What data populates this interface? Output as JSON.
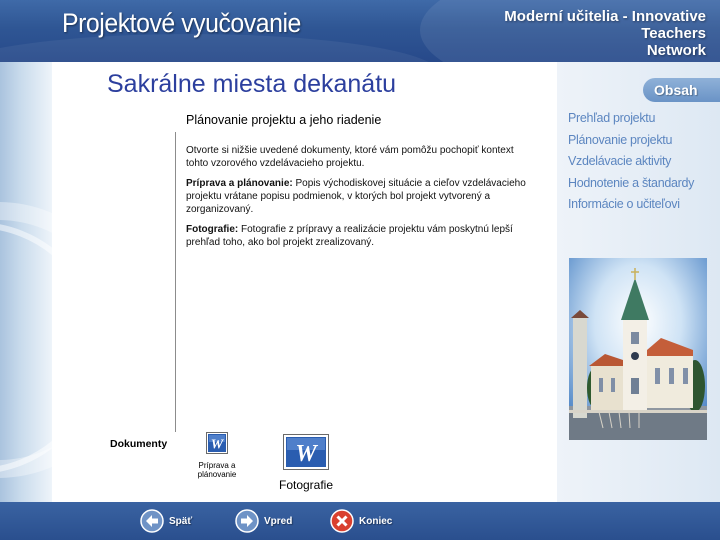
{
  "header": {
    "title": "Projektové vyučovanie",
    "network_lines": [
      "Moderní učitelia - Innovative",
      "Teachers",
      "Network"
    ]
  },
  "main": {
    "page_title": "Sakrálne miesta dekanátu",
    "section_heading": "Plánovanie projektu a jeho riadenie",
    "intro": "Otvorte si nižšie uvedené dokumenty, ktoré vám pomôžu pochopiť kontext tohto vzorového vzdelávacieho projektu.",
    "priprava_label": "Príprava a plánovanie:",
    "priprava_text": " Popis východiskovej situácie a cieľov vzdelávacieho projektu vrátane popisu podmienok, v ktorých bol projekt vytvorený a zorganizovaný.",
    "foto_label": "Fotografie:",
    "foto_text": " Fotografie z prípravy a realizácie projektu vám poskytnú lepší prehľad toho, ako bol projekt zrealizovaný."
  },
  "documents": {
    "label": "Dokumenty",
    "items": [
      {
        "label": "Príprava a plánovanie",
        "icon": "word-document-icon"
      },
      {
        "label": "Fotografie",
        "icon": "word-document-icon"
      }
    ]
  },
  "sidebar": {
    "tab_label": "Obsah",
    "items": [
      {
        "label": "Prehľad projektu"
      },
      {
        "label": "Plánovanie projektu"
      },
      {
        "label": "Vzdelávacie aktivity"
      },
      {
        "label": "Hodnotenie a štandardy"
      },
      {
        "label": "Informácie o učiteľovi"
      }
    ]
  },
  "footer": {
    "back_label": "Späť",
    "next_label": "Vpred",
    "end_label": "Koniec"
  },
  "colors": {
    "header_blue": "#2f5694",
    "title_blue": "#2c3f9e",
    "nav_blue": "#5c86c0",
    "word_blue": "#2a5db0"
  }
}
